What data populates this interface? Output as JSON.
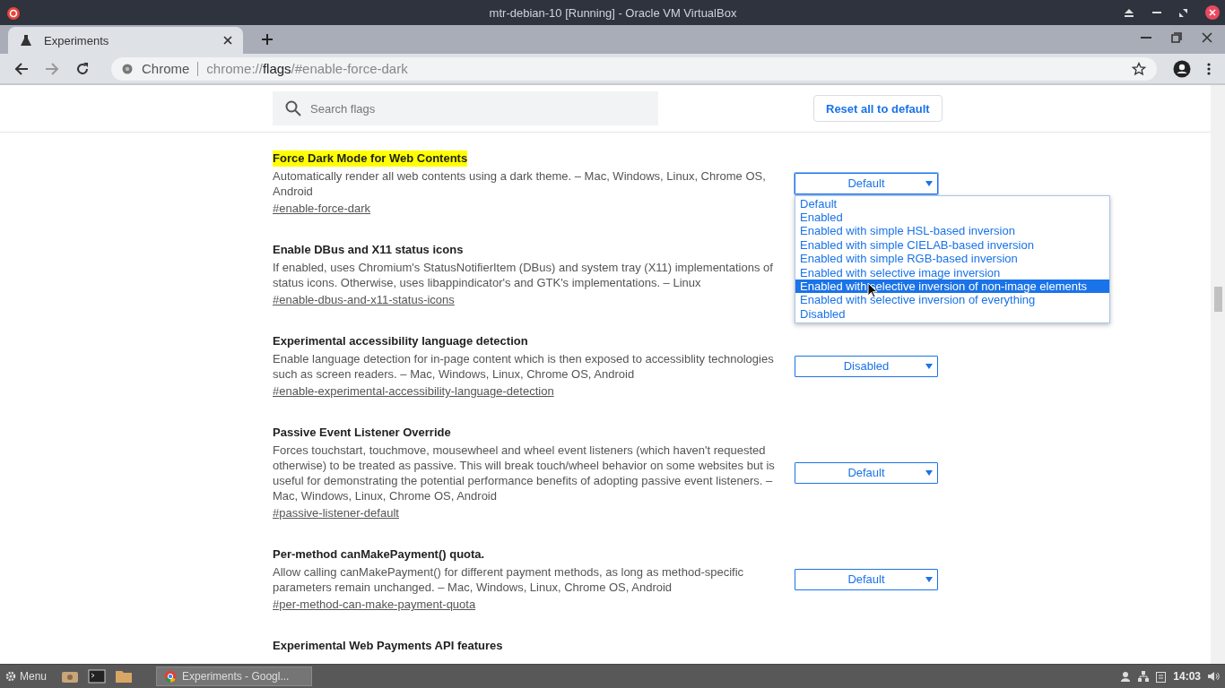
{
  "window": {
    "title": "mtr-debian-10 [Running] - Oracle VM VirtualBox"
  },
  "tabs": [
    {
      "label": "Experiments",
      "selected": true
    }
  ],
  "address_bar": {
    "site": "Chrome",
    "url": "chrome://**flags**/#enable-force-dark"
  },
  "search": {
    "placeholder": "Search flags"
  },
  "reset_button": "Reset all to default",
  "flags": [
    {
      "title": "Force Dark Mode for Web Contents",
      "highlighted": true,
      "description": "Automatically render all web contents using a dark theme. – Mac, Windows, Linux, Chrome OS, Android",
      "link": "#enable-force-dark",
      "select": "Default",
      "open": true
    },
    {
      "title": "Enable DBus and X11 status icons",
      "highlighted": false,
      "description": "If enabled, uses Chromium's StatusNotifierItem (DBus) and system tray (X11) implementations of status icons. Otherwise, uses libappindicator's and GTK's implementations. – Linux",
      "link": "#enable-dbus-and-x11-status-icons"
    },
    {
      "title": "Experimental accessibility language detection",
      "highlighted": false,
      "description": "Enable language detection for in-page content which is then exposed to accessiblity technologies such as screen readers. – Mac, Windows, Linux, Chrome OS, Android",
      "link": "#enable-experimental-accessibility-language-detection",
      "select": "Disabled",
      "open": false
    },
    {
      "title": "Passive Event Listener Override",
      "highlighted": false,
      "description": "Forces touchstart, touchmove, mousewheel and wheel event listeners (which haven't requested otherwise) to be treated as passive. This will break touch/wheel behavior on some websites but is useful for demonstrating the potential performance benefits of adopting passive event listeners. – Mac, Windows, Linux, Chrome OS, Android",
      "link": "#passive-listener-default",
      "select": "Default",
      "open": false
    },
    {
      "title": "Per-method canMakePayment() quota.",
      "highlighted": false,
      "description": "Allow calling canMakePayment() for different payment methods, as long as method-specific parameters remain unchanged. – Mac, Windows, Linux, Chrome OS, Android",
      "link": "#per-method-can-make-payment-quota",
      "select": "Default",
      "open": false
    },
    {
      "title": "Experimental Web Payments API features",
      "highlighted": false
    }
  ],
  "dropdown_options": [
    {
      "label": "Default",
      "selected": false
    },
    {
      "label": "Enabled",
      "selected": false
    },
    {
      "label": "Enabled with simple HSL-based inversion",
      "selected": false
    },
    {
      "label": "Enabled with simple CIELAB-based inversion",
      "selected": false
    },
    {
      "label": "Enabled with simple RGB-based inversion",
      "selected": false
    },
    {
      "label": "Enabled with selective image inversion",
      "selected": false
    },
    {
      "label": "Enabled with selective inversion of non-image elements",
      "selected": true
    },
    {
      "label": "Enabled with selective inversion of everything",
      "selected": false
    },
    {
      "label": "Disabled",
      "selected": false
    }
  ],
  "taskbar": {
    "menu": "Menu",
    "tasks": [
      {
        "label": "Experiments - Googl...",
        "selected": true
      }
    ],
    "clock": "14:03"
  }
}
